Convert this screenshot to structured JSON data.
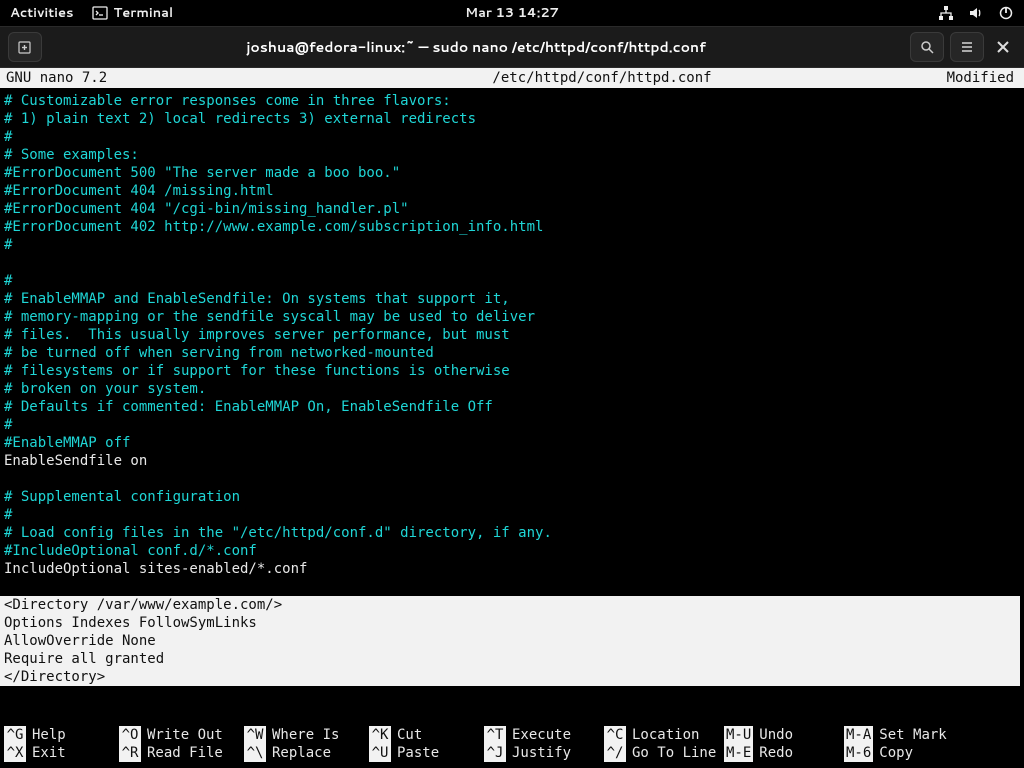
{
  "top_bar": {
    "activities": "Activities",
    "terminal_label": "Terminal",
    "clock": "Mar 13  14:27"
  },
  "window": {
    "title": "joshua@fedora-linux:~ — sudo nano /etc/httpd/conf/httpd.conf"
  },
  "nano": {
    "version": "GNU nano 7.2",
    "file": "/etc/httpd/conf/httpd.conf",
    "status": "Modified"
  },
  "lines": [
    {
      "c": "c-cyan",
      "t": "# Customizable error responses come in three flavors:"
    },
    {
      "c": "c-cyan",
      "t": "# 1) plain text 2) local redirects 3) external redirects"
    },
    {
      "c": "c-cyan",
      "t": "#"
    },
    {
      "c": "c-cyan",
      "t": "# Some examples:"
    },
    {
      "c": "c-cyan",
      "t": "#ErrorDocument 500 \"The server made a boo boo.\""
    },
    {
      "c": "c-cyan",
      "t": "#ErrorDocument 404 /missing.html"
    },
    {
      "c": "c-cyan",
      "t": "#ErrorDocument 404 \"/cgi-bin/missing_handler.pl\""
    },
    {
      "c": "c-cyan",
      "t": "#ErrorDocument 402 http://www.example.com/subscription_info.html"
    },
    {
      "c": "c-cyan",
      "t": "#"
    },
    {
      "c": "c-cyan",
      "t": ""
    },
    {
      "c": "c-cyan",
      "t": "#"
    },
    {
      "c": "c-cyan",
      "t": "# EnableMMAP and EnableSendfile: On systems that support it,"
    },
    {
      "c": "c-cyan",
      "t": "# memory-mapping or the sendfile syscall may be used to deliver"
    },
    {
      "c": "c-cyan",
      "t": "# files.  This usually improves server performance, but must"
    },
    {
      "c": "c-cyan",
      "t": "# be turned off when serving from networked-mounted"
    },
    {
      "c": "c-cyan",
      "t": "# filesystems or if support for these functions is otherwise"
    },
    {
      "c": "c-cyan",
      "t": "# broken on your system."
    },
    {
      "c": "c-cyan",
      "t": "# Defaults if commented: EnableMMAP On, EnableSendfile Off"
    },
    {
      "c": "c-cyan",
      "t": "#"
    },
    {
      "c": "c-cyan",
      "t": "#EnableMMAP off"
    },
    {
      "c": "c-white",
      "t": "EnableSendfile on"
    },
    {
      "c": "c-cyan",
      "t": ""
    },
    {
      "c": "c-cyan",
      "t": "# Supplemental configuration"
    },
    {
      "c": "c-cyan",
      "t": "#"
    },
    {
      "c": "c-cyan",
      "t": "# Load config files in the \"/etc/httpd/conf.d\" directory, if any."
    },
    {
      "c": "c-cyan",
      "t": "#IncludeOptional conf.d/*.conf"
    },
    {
      "c": "c-white",
      "t": "IncludeOptional sites-enabled/*.conf"
    },
    {
      "c": "c-white",
      "t": ""
    }
  ],
  "highlight": [
    "<Directory /var/www/example.com/>",
    "Options Indexes FollowSymLinks",
    "AllowOverride None",
    "Require all granted",
    "</Directory>"
  ],
  "shortcuts_row1": [
    {
      "k": "^G",
      "l": "Help"
    },
    {
      "k": "^O",
      "l": "Write Out"
    },
    {
      "k": "^W",
      "l": "Where Is"
    },
    {
      "k": "^K",
      "l": "Cut"
    },
    {
      "k": "^T",
      "l": "Execute"
    },
    {
      "k": "^C",
      "l": "Location"
    },
    {
      "k": "M-U",
      "l": "Undo"
    }
  ],
  "shortcuts_row1_extra": {
    "k": "M-A",
    "l": "Set Mark"
  },
  "shortcuts_row2": [
    {
      "k": "^X",
      "l": "Exit"
    },
    {
      "k": "^R",
      "l": "Read File"
    },
    {
      "k": "^\\",
      "l": "Replace"
    },
    {
      "k": "^U",
      "l": "Paste"
    },
    {
      "k": "^J",
      "l": "Justify"
    },
    {
      "k": "^/",
      "l": "Go To Line"
    },
    {
      "k": "M-E",
      "l": "Redo"
    }
  ],
  "shortcuts_row2_extra": {
    "k": "M-6",
    "l": "Copy"
  }
}
